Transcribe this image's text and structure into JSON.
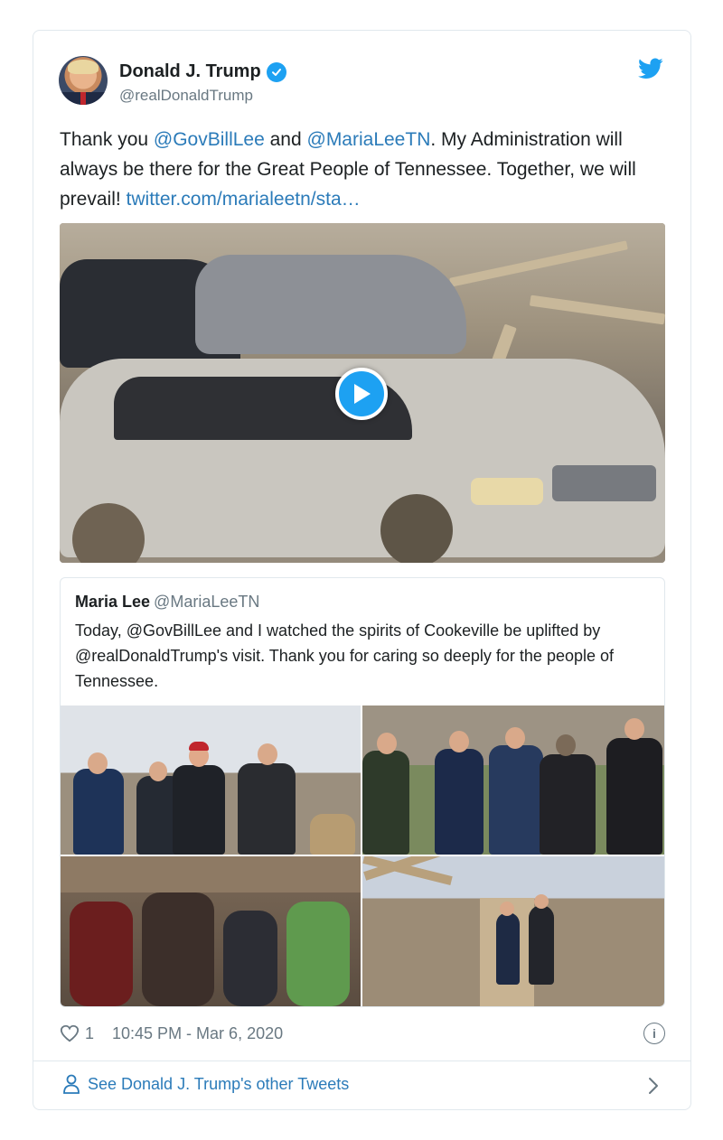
{
  "tweet": {
    "display_name": "Donald J. Trump",
    "handle": "@realDonaldTrump",
    "verified": true,
    "text_parts": {
      "p1": "Thank you ",
      "mention1": "@GovBillLee",
      "p2": " and ",
      "mention2": "@MariaLeeTN",
      "p3": ". My Administration will always be there for the Great People of Tennessee. Together, we will prevail! ",
      "link": "twitter.com/marialeetn/sta…"
    },
    "media_type": "video",
    "likes": "1",
    "timestamp": "10:45 PM - Mar 6, 2020"
  },
  "quote": {
    "name": "Maria Lee",
    "handle": "@MariaLeeTN",
    "text": "Today, @GovBillLee and I watched the spirits of Cookeville be uplifted by @realDonaldTrump's visit. Thank you for caring so deeply for the people of Tennessee.",
    "photo_count": 4
  },
  "footer": {
    "see_more": "See Donald J. Trump's other Tweets"
  },
  "colors": {
    "link": "#2b7bb9",
    "twitter_blue": "#1da1f2",
    "muted": "#697882",
    "border": "#e1e8ed"
  },
  "icons": [
    "twitter-bird-icon",
    "verified-badge-icon",
    "play-icon",
    "heart-icon",
    "info-icon",
    "person-icon",
    "chevron-right-icon"
  ]
}
